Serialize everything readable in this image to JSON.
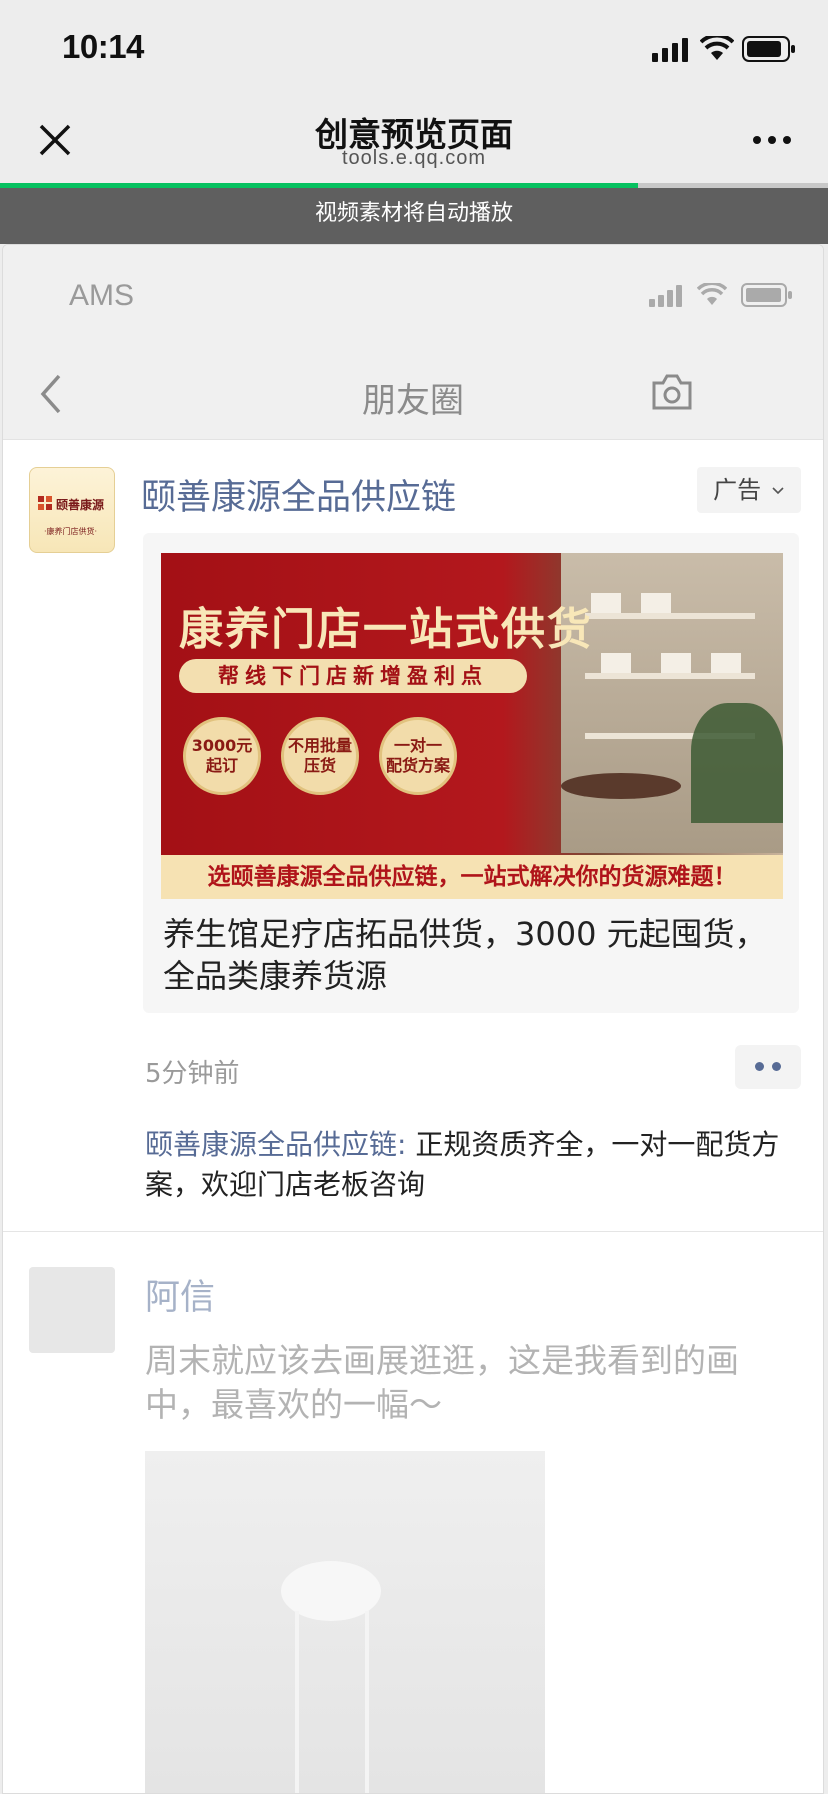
{
  "status_bar": {
    "time": "10:14"
  },
  "nav": {
    "title": "创意预览页面",
    "subtitle": "tools.e.qq.com",
    "progress": 0.77
  },
  "banner": {
    "text": "视频素材将自动播放"
  },
  "inner": {
    "carrier": "AMS",
    "title": "朋友圈"
  },
  "ad": {
    "avatar_name": "颐善康源",
    "avatar_sub": "·康养门店供货·",
    "name": "颐善康源全品供应链",
    "tag": "广告",
    "creative": {
      "headline": "康养门店一站式供货",
      "ribbon": "帮线下门店新增盈利点",
      "badges": [
        "3000元 起订",
        "不用批量 压货",
        "一对一 配货方案"
      ],
      "slogan": "选颐善康源全品供应链，一站式解决你的货源难题！"
    },
    "description": "养生馆足疗店拓品供货，3000 元起囤货，全品类康养货源",
    "time": "5分钟前",
    "comment_name": "颐善康源全品供应链:",
    "comment_text": " 正规资质齐全，一对一配货方案，欢迎门店老板咨询"
  },
  "post2": {
    "name": "阿信",
    "text": "周末就应该去画展逛逛，这是我看到的画中，最喜欢的一幅～"
  },
  "colors": {
    "accent": "#07c160",
    "link": "#576b95",
    "ad_red": "#a31015"
  }
}
